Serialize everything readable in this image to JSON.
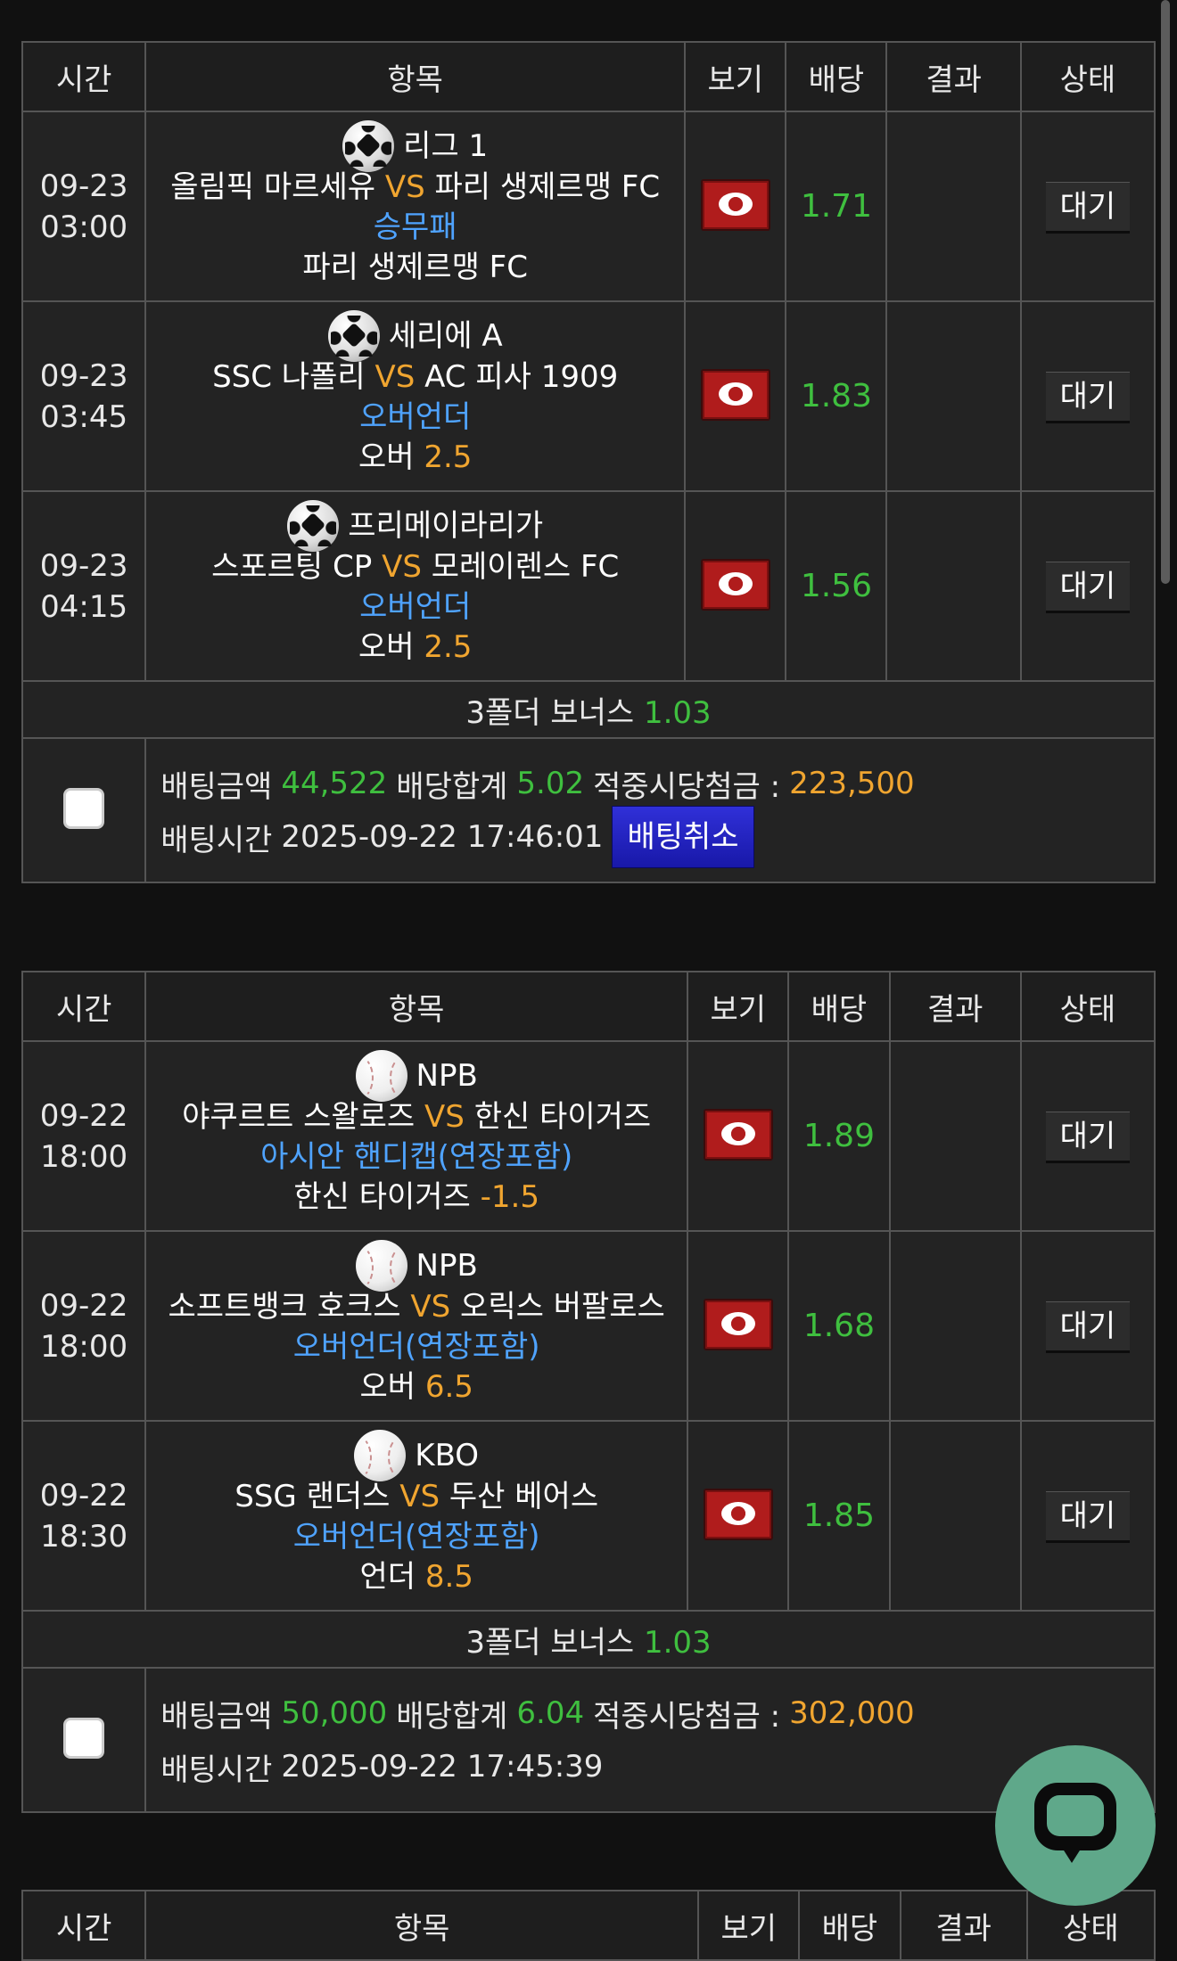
{
  "headers": {
    "time": "시간",
    "item": "항목",
    "view": "보기",
    "odds": "배당",
    "result": "결과",
    "status": "상태"
  },
  "bets": [
    {
      "games": [
        {
          "date": "09-23",
          "time": "03:00",
          "sport": "soccer",
          "league": "리그 1",
          "home": "올림픽 마르세유",
          "vs": "VS",
          "away": "파리 생제르맹 FC",
          "market": "승무패",
          "pick": "파리 생제르맹 FC",
          "line": "",
          "odds": "1.71",
          "result": "",
          "status": "대기"
        },
        {
          "date": "09-23",
          "time": "03:45",
          "sport": "soccer",
          "league": "세리에 A",
          "home": "SSC 나폴리",
          "vs": "VS",
          "away": "AC 피사 1909",
          "market": "오버언더",
          "pick": "오버",
          "line": "2.5",
          "odds": "1.83",
          "result": "",
          "status": "대기"
        },
        {
          "date": "09-23",
          "time": "04:15",
          "sport": "soccer",
          "league": "프리메이라리가",
          "home": "스포르팅 CP",
          "vs": "VS",
          "away": "모레이렌스 FC",
          "market": "오버언더",
          "pick": "오버",
          "line": "2.5",
          "odds": "1.56",
          "result": "",
          "status": "대기"
        }
      ],
      "bonus_label": "3폴더 보너스",
      "bonus_value": "1.03",
      "amount_label": "배팅금액",
      "amount": "44,522",
      "total_odds_label": "배당합계",
      "total_odds": "5.02",
      "payout_label": "적중시당첨금 :",
      "payout": "223,500",
      "time_label": "배팅시간",
      "bet_time": "2025-09-22 17:46:01",
      "cancel_label": "배팅취소",
      "checked": false
    },
    {
      "games": [
        {
          "date": "09-22",
          "time": "18:00",
          "sport": "baseball",
          "league": "NPB",
          "home": "야쿠르트 스왈로즈",
          "vs": "VS",
          "away": "한신 타이거즈",
          "market": "아시안 핸디캡(연장포함)",
          "pick": "한신 타이거즈",
          "line": "-1.5",
          "odds": "1.89",
          "result": "",
          "status": "대기"
        },
        {
          "date": "09-22",
          "time": "18:00",
          "sport": "baseball",
          "league": "NPB",
          "home": "소프트뱅크 호크스",
          "vs": "VS",
          "away": "오릭스 버팔로스",
          "market": "오버언더(연장포함)",
          "pick": "오버",
          "line": "6.5",
          "odds": "1.68",
          "result": "",
          "status": "대기"
        },
        {
          "date": "09-22",
          "time": "18:30",
          "sport": "baseball",
          "league": "KBO",
          "home": "SSG 랜더스",
          "vs": "VS",
          "away": "두산 베어스",
          "market": "오버언더(연장포함)",
          "pick": "언더",
          "line": "8.5",
          "odds": "1.85",
          "result": "",
          "status": "대기"
        }
      ],
      "bonus_label": "3폴더 보너스",
      "bonus_value": "1.03",
      "amount_label": "배팅금액",
      "amount": "50,000",
      "total_odds_label": "배당합계",
      "total_odds": "6.04",
      "payout_label": "적중시당첨금 :",
      "payout": "302,000",
      "time_label": "배팅시간",
      "bet_time": "2025-09-22 17:45:39",
      "cancel_label": "",
      "checked": false
    }
  ],
  "icons": {
    "view": "eye-icon",
    "soccer": "soccer-ball-icon",
    "baseball": "baseball-icon",
    "chat": "chat-bubble-icon"
  },
  "colors": {
    "background": "#111111",
    "odds": "#3fbf3f",
    "vs": "#f0a530",
    "market": "#4fa3ff",
    "view_button": "#b01c1c",
    "cancel_button": "#2222c8",
    "chat_button": "#5fa88a"
  }
}
